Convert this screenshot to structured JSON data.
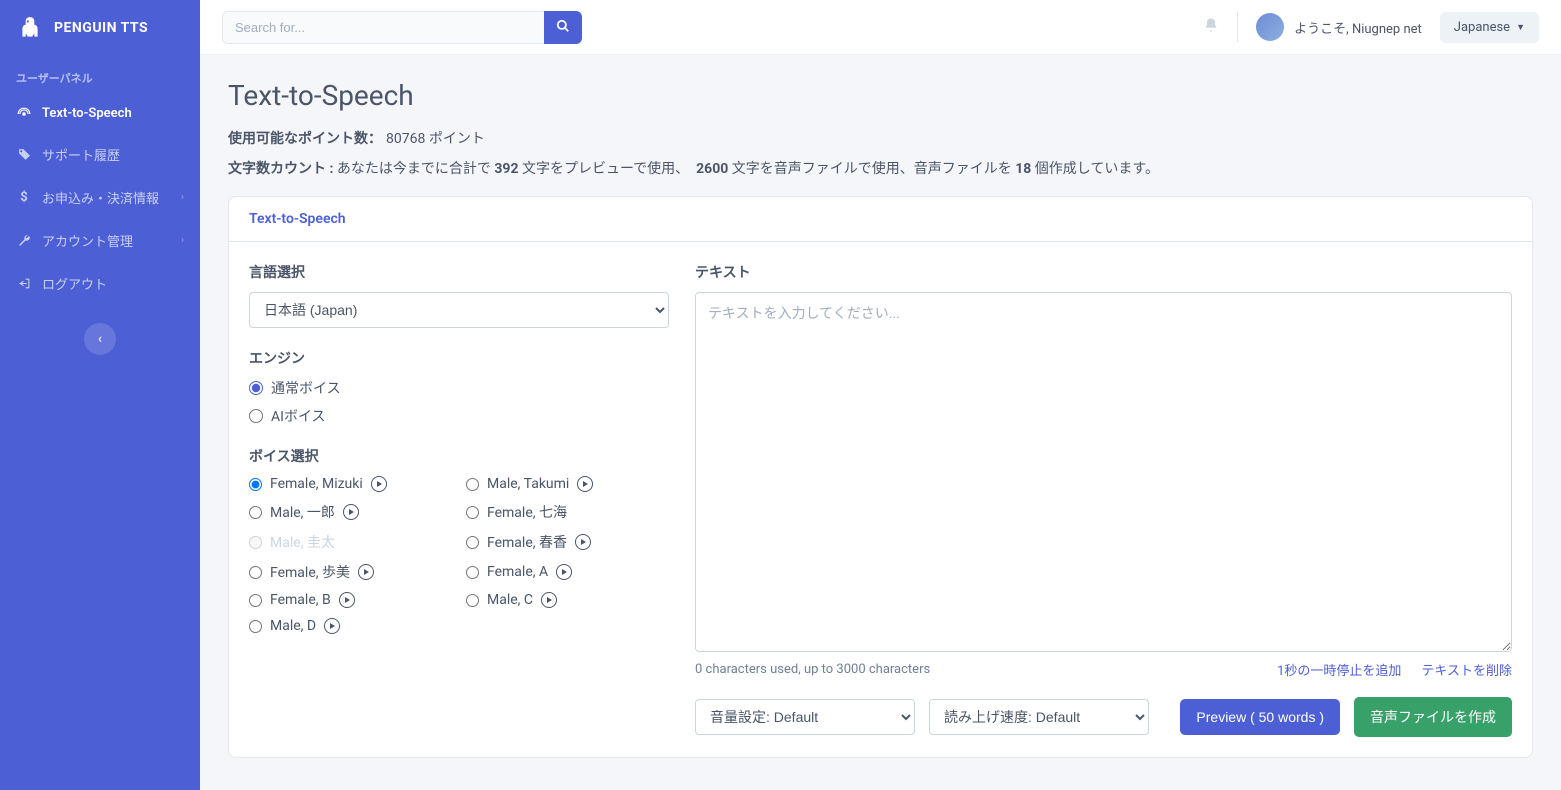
{
  "brand": {
    "name": "PENGUIN TTS"
  },
  "sidebar": {
    "panel_label": "ユーザーパネル",
    "items": [
      {
        "label": "Text-to-Speech",
        "icon": "broadcast",
        "active": true
      },
      {
        "label": "サポート履歴",
        "icon": "tag"
      },
      {
        "label": "お申込み・決済情報",
        "icon": "dollar",
        "has_chevron": true
      },
      {
        "label": "アカウント管理",
        "icon": "wrench",
        "has_chevron": true
      },
      {
        "label": "ログアウト",
        "icon": "logout"
      }
    ]
  },
  "topbar": {
    "search_placeholder": "Search for...",
    "welcome_prefix": "ようこそ, ",
    "username": "Niugnep net",
    "language": "Japanese"
  },
  "page": {
    "title": "Text-to-Speech",
    "points_label": "使用可能なポイント数：",
    "points_value": "80768 ポイント",
    "char_count_label": "文字数カウント : ",
    "char_count_pre": "あなたは今までに合計で ",
    "char_count_preview_n": "392",
    "char_count_mid1": " 文字をプレビューで使用、　",
    "char_count_file_n": "2600",
    "char_count_mid2": " 文字を音声ファイルで使用、音声ファイルを ",
    "char_count_files_n": "18",
    "char_count_suffix": " 個作成しています。"
  },
  "card": {
    "header": "Text-to-Speech"
  },
  "form": {
    "lang_label": "言語選択",
    "lang_value": "日本語 (Japan)",
    "engine_label": "エンジン",
    "engine_options": [
      {
        "label": "通常ボイス",
        "checked": true
      },
      {
        "label": "AIボイス",
        "checked": false
      }
    ],
    "voice_label": "ボイス選択",
    "voices": [
      {
        "label": "Female, Mizuki",
        "checked": true,
        "play": true
      },
      {
        "label": "Male, Takumi",
        "checked": false,
        "play": true
      },
      {
        "label": "Male, 一郎",
        "checked": false,
        "play": true
      },
      {
        "label": "Female, 七海",
        "checked": false,
        "play": false
      },
      {
        "label": "Male, 圭太",
        "checked": false,
        "play": false,
        "disabled": true
      },
      {
        "label": "Female, 春香",
        "checked": false,
        "play": true
      },
      {
        "label": "Female, 歩美",
        "checked": false,
        "play": true
      },
      {
        "label": "Female, A",
        "checked": false,
        "play": true
      },
      {
        "label": "Female, B",
        "checked": false,
        "play": true
      },
      {
        "label": "Male, C",
        "checked": false,
        "play": true
      },
      {
        "label": "Male, D",
        "checked": false,
        "play": true
      }
    ],
    "text_label": "テキスト",
    "text_placeholder": "テキストを入力してください...",
    "char_used_text": "0 characters used, up to 3000 characters",
    "link_pause": "1秒の一時停止を追加",
    "link_clear": "テキストを削除",
    "volume_select": "音量設定: Default",
    "rate_select": "読み上げ速度: Default",
    "preview_btn": "Preview ( 50 words )",
    "create_btn": "音声ファイルを作成"
  }
}
